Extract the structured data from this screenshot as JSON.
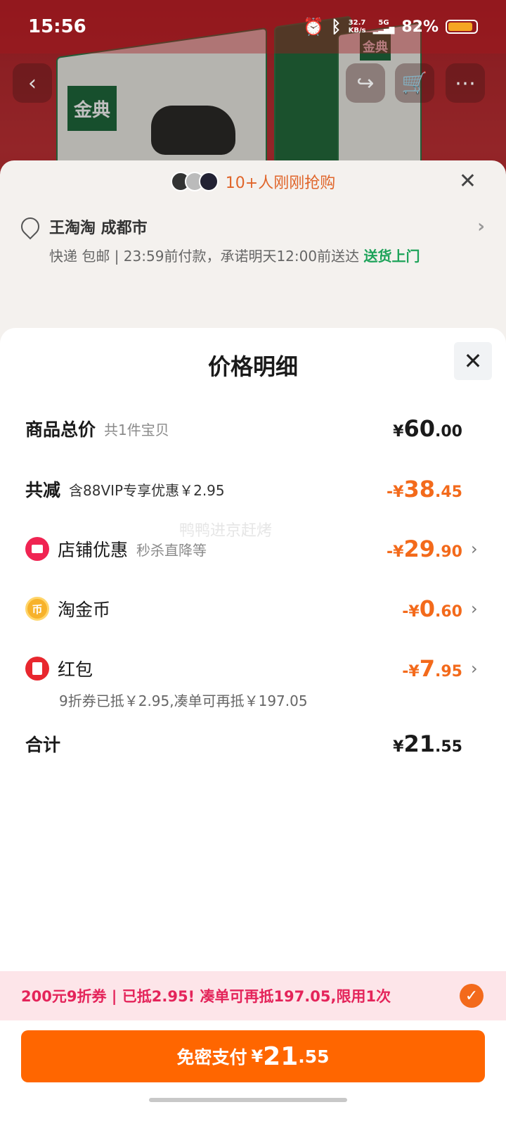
{
  "status_bar": {
    "time": "15:56",
    "speed_top": "32.7",
    "speed_bottom": "KB/s",
    "network": "5G",
    "battery": "82%",
    "icons": [
      "alarm-icon",
      "bluetooth-icon",
      "signal-icon",
      "battery-icon"
    ]
  },
  "background": {
    "brand_text": "金典",
    "buyers_text": "10+人刚刚抢购",
    "address_name": "王淘淘 成都市",
    "delivery_text": "快递 包邮 | 23:59前付款，承诺明天12:00前送达",
    "delivery_link": "送货上门"
  },
  "sheet": {
    "title": "价格明细",
    "watermark": "鸭鸭进京赶烤",
    "total": {
      "label": "商品总价",
      "sub": "共1件宝贝",
      "yen": "¥",
      "int": "60",
      "dec": ".00"
    },
    "discount": {
      "label": "共减",
      "sub": "含88VIP专享优惠￥2.95",
      "yen": "-¥",
      "int": "38",
      "dec": ".45"
    },
    "shop": {
      "label": "店铺优惠",
      "sub": "秒杀直降等",
      "yen": "-¥",
      "int": "29",
      "dec": ".90"
    },
    "coins": {
      "label": "淘金币",
      "yen": "-¥",
      "int": "0",
      "dec": ".60"
    },
    "redpacket": {
      "label": "红包",
      "yen": "-¥",
      "int": "7",
      "dec": ".95",
      "note": "9折券已抵￥2.95,凑单可再抵￥197.05"
    },
    "sum": {
      "label": "合计",
      "yen": "¥",
      "int": "21",
      "dec": ".55"
    },
    "coupon": "200元9折券 | 已抵2.95! 凑单可再抵197.05,限用1次",
    "pay": {
      "label": "免密支付",
      "yen": "¥",
      "int": "21",
      "dec": ".55"
    }
  },
  "colors": {
    "accent": "#ff6600",
    "discount": "#f36a1b",
    "coupon_text": "#e4245a",
    "coupon_bg": "#fde5e9"
  }
}
